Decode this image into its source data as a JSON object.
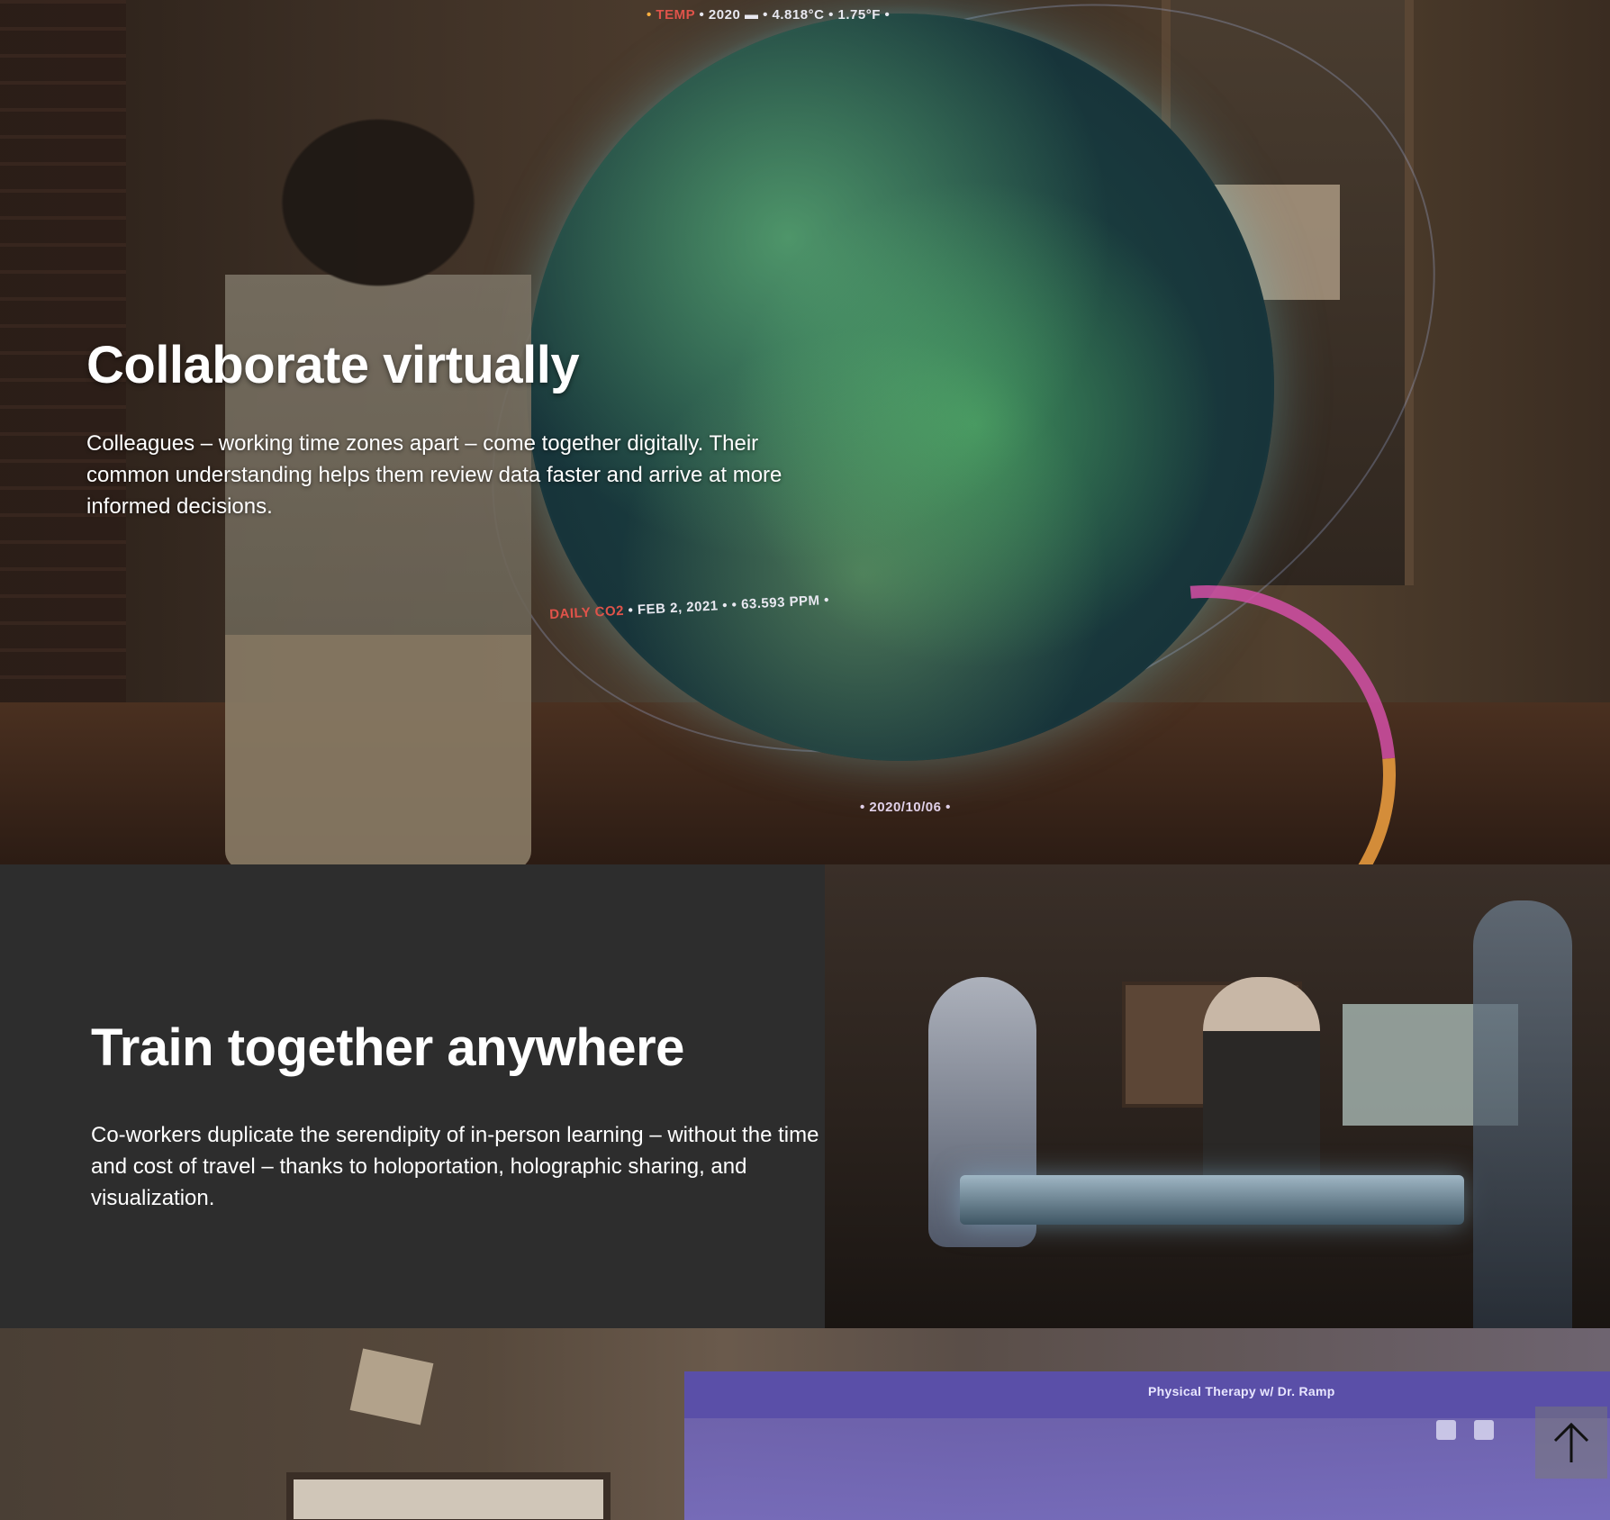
{
  "hero": {
    "title": "Collaborate virtually",
    "body": "Colleagues – working time zones apart – come together digitally. Their common understanding helps them review data faster and arrive at more informed decisions.",
    "hud": {
      "temp_label": "TEMP",
      "temp_value": "• 2020 ▬ • 4.818°C • 1.75°F •",
      "co2_label": "DAILY CO2",
      "co2_value": "• FEB 2, 2021 • • 63.593 PPM •",
      "date": "• 2020/10/06 •"
    }
  },
  "section2": {
    "title": "Train together anywhere",
    "body": "Co-workers duplicate the serendipity of in-person learning – without the time and cost of travel – thanks to holoportation, holographic sharing, and visualization."
  },
  "section3": {
    "panel_title": "Physical Therapy w/ Dr. Ramp"
  },
  "icons": {
    "back_to_top": "arrow-up-icon"
  }
}
